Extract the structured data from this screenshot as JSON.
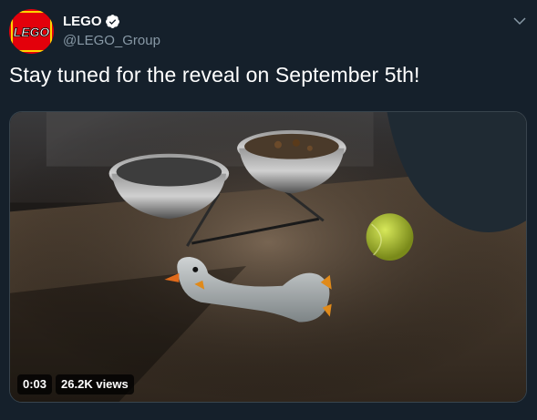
{
  "author": {
    "name": "LEGO",
    "handle": "@LEGO_Group",
    "verified": true,
    "avatar_text": "LEGO"
  },
  "tweet": {
    "text": "Stay tuned for the reveal on September 5th!"
  },
  "video": {
    "time": "0:03",
    "views": "26.2K views"
  },
  "colors": {
    "background": "#15202b",
    "secondary_text": "#8899a6",
    "lego_red": "#e3000b",
    "lego_yellow": "#ffd500"
  },
  "icons": {
    "verified": "verified-badge-icon",
    "more": "chevron-down-icon"
  }
}
